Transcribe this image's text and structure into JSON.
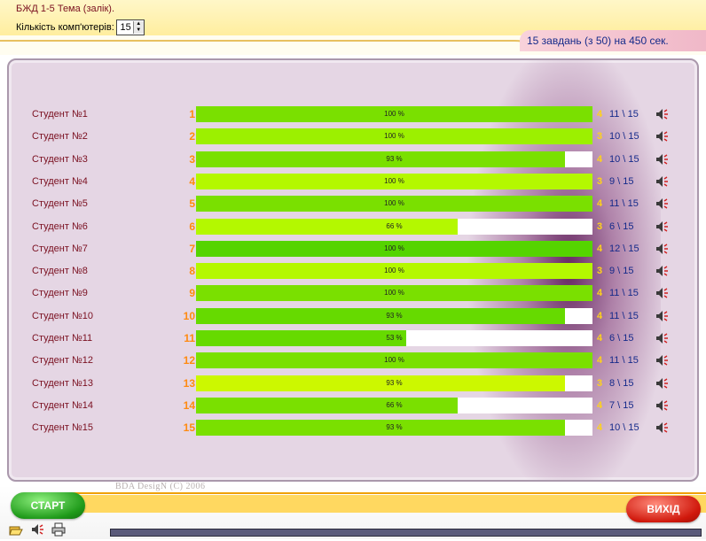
{
  "header": {
    "title": "БЖД   1-5 Тема (залік).",
    "computers_label": "Кількість комп'ютерів:",
    "computers_value": "15",
    "tasks_info": "15 завдань (з 50) на 450 сек."
  },
  "students": [
    {
      "name": "Студент №1",
      "num": "1",
      "percent": "100 %",
      "fill": 1.0,
      "color": "#7ae000",
      "grade": "4",
      "score": "11 \\ 15"
    },
    {
      "name": "Студент №2",
      "num": "2",
      "percent": "100 %",
      "fill": 1.0,
      "color": "#9cf000",
      "grade": "3",
      "score": "10 \\ 15"
    },
    {
      "name": "Студент №3",
      "num": "3",
      "percent": "93 %",
      "fill": 0.93,
      "color": "#7ae000",
      "grade": "4",
      "score": "10 \\ 15"
    },
    {
      "name": "Студент №4",
      "num": "4",
      "percent": "100 %",
      "fill": 1.0,
      "color": "#b4f800",
      "grade": "3",
      "score": "9 \\ 15"
    },
    {
      "name": "Студент №5",
      "num": "5",
      "percent": "100 %",
      "fill": 1.0,
      "color": "#7ae000",
      "grade": "4",
      "score": "11 \\ 15"
    },
    {
      "name": "Студент №6",
      "num": "6",
      "percent": "66 %",
      "fill": 0.66,
      "color": "#b4f800",
      "grade": "3",
      "score": "6 \\ 15"
    },
    {
      "name": "Студент №7",
      "num": "7",
      "percent": "100 %",
      "fill": 1.0,
      "color": "#55d400",
      "grade": "4",
      "score": "12 \\ 15"
    },
    {
      "name": "Студент №8",
      "num": "8",
      "percent": "100 %",
      "fill": 1.0,
      "color": "#b4f800",
      "grade": "3",
      "score": "9 \\ 15"
    },
    {
      "name": "Студент №9",
      "num": "9",
      "percent": "100 %",
      "fill": 1.0,
      "color": "#7ae000",
      "grade": "4",
      "score": "11 \\ 15"
    },
    {
      "name": "Студент №10",
      "num": "10",
      "percent": "93 %",
      "fill": 0.93,
      "color": "#66da00",
      "grade": "4",
      "score": "11 \\ 15"
    },
    {
      "name": "Студент №11",
      "num": "11",
      "percent": "53 %",
      "fill": 0.53,
      "color": "#66da00",
      "grade": "4",
      "score": "6 \\ 15"
    },
    {
      "name": "Студент №12",
      "num": "12",
      "percent": "100 %",
      "fill": 1.0,
      "color": "#7ae000",
      "grade": "4",
      "score": "11 \\ 15"
    },
    {
      "name": "Студент №13",
      "num": "13",
      "percent": "93 %",
      "fill": 0.93,
      "color": "#ccf800",
      "grade": "3",
      "score": "8 \\ 15"
    },
    {
      "name": "Студент №14",
      "num": "14",
      "percent": "66 %",
      "fill": 0.66,
      "color": "#7ae000",
      "grade": "4",
      "score": "7 \\ 15"
    },
    {
      "name": "Студент №15",
      "num": "15",
      "percent": "93 %",
      "fill": 0.93,
      "color": "#7ae000",
      "grade": "4",
      "score": "10 \\ 15"
    }
  ],
  "footer": {
    "credit": "BDA DesigN (C) 2006",
    "start_label": "СТАРТ",
    "exit_label": "ВИХІД",
    "tool_icons": [
      "folder-open-icon",
      "speaker-icon",
      "print-icon"
    ]
  },
  "colors": {
    "accent_orange": "#ff8a10",
    "grade_yellow": "#ffd21a",
    "label_red": "#7a1020",
    "score_blue": "#152a8a"
  }
}
